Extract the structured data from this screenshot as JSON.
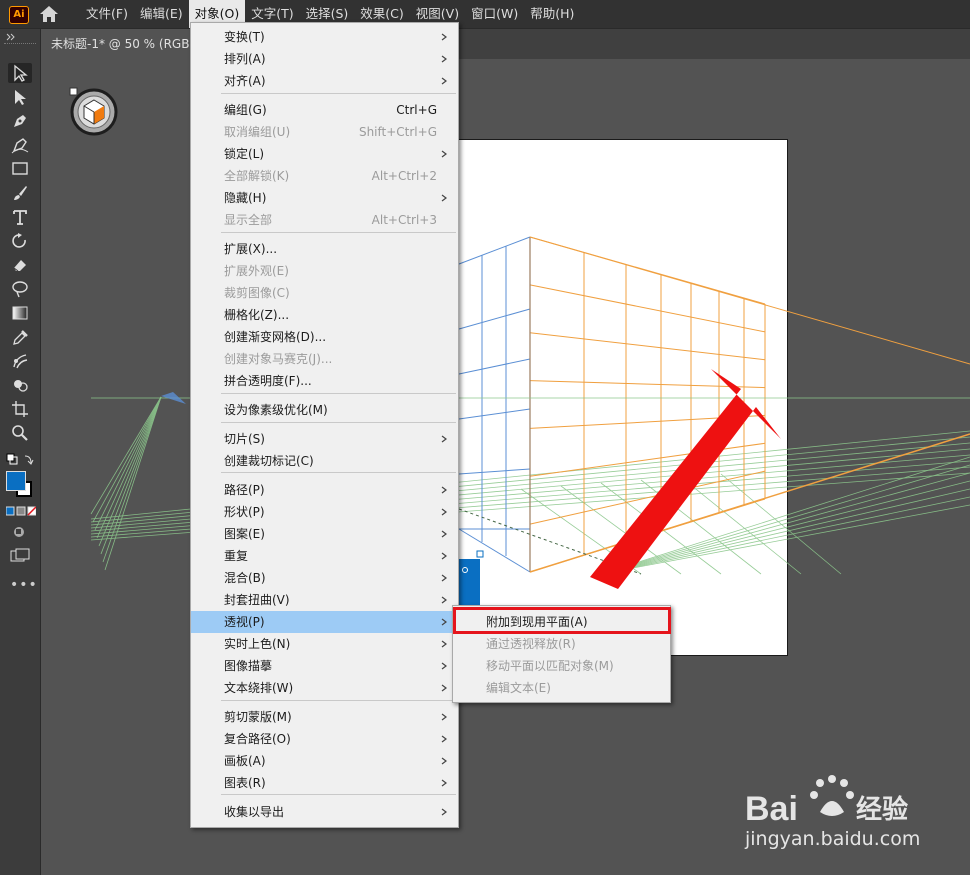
{
  "app": {
    "logo": "Ai"
  },
  "menubar": {
    "items": [
      {
        "label": "文件(F)"
      },
      {
        "label": "编辑(E)"
      },
      {
        "label": "对象(O)",
        "active": true
      },
      {
        "label": "文字(T)"
      },
      {
        "label": "选择(S)"
      },
      {
        "label": "效果(C)"
      },
      {
        "label": "视图(V)"
      },
      {
        "label": "窗口(W)"
      },
      {
        "label": "帮助(H)"
      }
    ]
  },
  "document": {
    "tab_title": "未标题-1* @ 50 % (RGB"
  },
  "object_menu": {
    "items": [
      {
        "label": "变换(T)",
        "submenu": true
      },
      {
        "label": "排列(A)",
        "submenu": true
      },
      {
        "label": "对齐(A)",
        "submenu": true
      },
      {
        "label": "编组(G)",
        "shortcut": "Ctrl+G"
      },
      {
        "label": "取消编组(U)",
        "shortcut": "Shift+Ctrl+G",
        "disabled": true
      },
      {
        "label": "锁定(L)",
        "submenu": true
      },
      {
        "label": "全部解锁(K)",
        "shortcut": "Alt+Ctrl+2",
        "disabled": true
      },
      {
        "label": "隐藏(H)",
        "submenu": true
      },
      {
        "label": "显示全部",
        "shortcut": "Alt+Ctrl+3",
        "disabled": true
      },
      {
        "label": "扩展(X)..."
      },
      {
        "label": "扩展外观(E)",
        "disabled": true
      },
      {
        "label": "裁剪图像(C)",
        "disabled": true
      },
      {
        "label": "栅格化(Z)..."
      },
      {
        "label": "创建渐变网格(D)..."
      },
      {
        "label": "创建对象马赛克(J)...",
        "disabled": true
      },
      {
        "label": "拼合透明度(F)..."
      },
      {
        "label": "设为像素级优化(M)"
      },
      {
        "label": "切片(S)",
        "submenu": true
      },
      {
        "label": "创建裁切标记(C)"
      },
      {
        "label": "路径(P)",
        "submenu": true
      },
      {
        "label": "形状(P)",
        "submenu": true
      },
      {
        "label": "图案(E)",
        "submenu": true
      },
      {
        "label": "重复",
        "submenu": true
      },
      {
        "label": "混合(B)",
        "submenu": true
      },
      {
        "label": "封套扭曲(V)",
        "submenu": true
      },
      {
        "label": "透视(P)",
        "submenu": true,
        "highlighted": true
      },
      {
        "label": "实时上色(N)",
        "submenu": true
      },
      {
        "label": "图像描摹",
        "submenu": true
      },
      {
        "label": "文本绕排(W)",
        "submenu": true
      },
      {
        "label": "剪切蒙版(M)",
        "submenu": true
      },
      {
        "label": "复合路径(O)",
        "submenu": true
      },
      {
        "label": "画板(A)",
        "submenu": true
      },
      {
        "label": "图表(R)",
        "submenu": true
      },
      {
        "label": "收集以导出",
        "submenu": true
      }
    ]
  },
  "perspective_submenu": {
    "items": [
      {
        "label": "附加到现用平面(A)"
      },
      {
        "label": "通过透视释放(R)",
        "disabled": true
      },
      {
        "label": "移动平面以匹配对象(M)",
        "disabled": true
      },
      {
        "label": "编辑文本(E)",
        "disabled": true
      }
    ]
  },
  "watermark": {
    "text": "jingyan.baidu.com",
    "brand_a": "Bai",
    "brand_b": "经验"
  },
  "colors": {
    "menubar": "#323232",
    "workspace": "#535353",
    "menu_bg": "#f0f0f0",
    "menu_highlight": "#9dcbf5",
    "callout_red": "#e5141c",
    "grid_left": "#5b8fd4",
    "grid_right": "#f0a040",
    "grid_ground": "#8cc78c",
    "fill_color": "#0a6fc2"
  }
}
